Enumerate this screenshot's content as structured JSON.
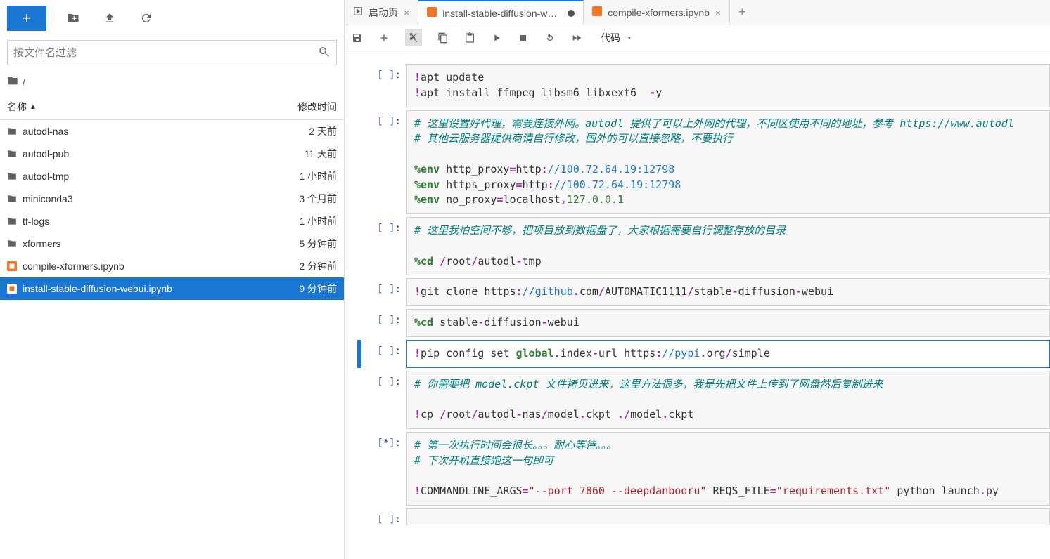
{
  "sidebar": {
    "search_placeholder": "按文件名过滤",
    "breadcrumb_root": "/",
    "header_name": "名称",
    "header_modified": "修改时间",
    "files": [
      {
        "name": "autodl-nas",
        "modified": "2 天前",
        "type": "folder"
      },
      {
        "name": "autodl-pub",
        "modified": "11 天前",
        "type": "folder"
      },
      {
        "name": "autodl-tmp",
        "modified": "1 小时前",
        "type": "folder"
      },
      {
        "name": "miniconda3",
        "modified": "3 个月前",
        "type": "folder"
      },
      {
        "name": "tf-logs",
        "modified": "1 小时前",
        "type": "folder"
      },
      {
        "name": "xformers",
        "modified": "5 分钟前",
        "type": "folder"
      },
      {
        "name": "compile-xformers.ipynb",
        "modified": "2 分钟前",
        "type": "notebook"
      },
      {
        "name": "install-stable-diffusion-webui.ipynb",
        "modified": "9 分钟前",
        "type": "notebook",
        "selected": true
      }
    ]
  },
  "tabs": [
    {
      "label": "启动页",
      "icon": "launcher",
      "closable": true
    },
    {
      "label": "install-stable-diffusion-webu",
      "icon": "notebook",
      "active": true,
      "dirty": true
    },
    {
      "label": "compile-xformers.ipynb",
      "icon": "notebook",
      "closable": true
    }
  ],
  "nb_toolbar": {
    "cell_type": "代码"
  },
  "cells": [
    {
      "prompt": "[ ]:",
      "tokens": [
        [
          "op",
          "!"
        ],
        [
          "",
          "apt update\n"
        ],
        [
          "op",
          "!"
        ],
        [
          "",
          "apt install ffmpeg libsm6 libxext6  "
        ],
        [
          "op",
          "-"
        ],
        [
          "",
          "y"
        ]
      ]
    },
    {
      "prompt": "[ ]:",
      "tokens": [
        [
          "cm",
          "# 这里设置好代理，需要连接外网。autodl 提供了可以上外网的代理，不同区使用不同的地址，参考 https://www.autodl"
        ],
        [
          "",
          "\n"
        ],
        [
          "cm",
          "# 其他云服务器提供商请自行修改，国外的可以直接忽略，不要执行"
        ],
        [
          "",
          "\n\n"
        ],
        [
          "mg",
          "%env"
        ],
        [
          "",
          " http_proxy"
        ],
        [
          "op",
          "="
        ],
        [
          "",
          "http"
        ],
        [
          "op",
          ":"
        ],
        [
          "url",
          "//100.72.64.19:12798"
        ],
        [
          "",
          "\n"
        ],
        [
          "mg",
          "%env"
        ],
        [
          "",
          " https_proxy"
        ],
        [
          "op",
          "="
        ],
        [
          "",
          "http"
        ],
        [
          "op",
          ":"
        ],
        [
          "url",
          "//100.72.64.19:12798"
        ],
        [
          "",
          "\n"
        ],
        [
          "mg",
          "%env"
        ],
        [
          "",
          " no_proxy"
        ],
        [
          "op",
          "="
        ],
        [
          "",
          "localhost"
        ],
        [
          "op",
          ","
        ],
        [
          "num",
          "127.0.0.1"
        ]
      ]
    },
    {
      "prompt": "[ ]:",
      "tokens": [
        [
          "cm",
          "# 这里我怕空间不够，把项目放到数据盘了，大家根据需要自行调整存放的目录"
        ],
        [
          "",
          "\n\n"
        ],
        [
          "mg",
          "%cd"
        ],
        [
          "",
          " "
        ],
        [
          "op",
          "/"
        ],
        [
          "",
          "root"
        ],
        [
          "op",
          "/"
        ],
        [
          "",
          "autodl"
        ],
        [
          "op",
          "-"
        ],
        [
          "",
          "tmp"
        ]
      ]
    },
    {
      "prompt": "[ ]:",
      "tokens": [
        [
          "op",
          "!"
        ],
        [
          "",
          "git clone https"
        ],
        [
          "op",
          ":"
        ],
        [
          "url",
          "//github"
        ],
        [
          "op",
          "."
        ],
        [
          "",
          "com"
        ],
        [
          "op",
          "/"
        ],
        [
          "",
          "AUTOMATIC1111"
        ],
        [
          "op",
          "/"
        ],
        [
          "",
          "stable"
        ],
        [
          "op",
          "-"
        ],
        [
          "",
          "diffusion"
        ],
        [
          "op",
          "-"
        ],
        [
          "",
          "webui"
        ]
      ]
    },
    {
      "prompt": "[ ]:",
      "tokens": [
        [
          "mg",
          "%cd"
        ],
        [
          "",
          " stable"
        ],
        [
          "op",
          "-"
        ],
        [
          "",
          "diffusion"
        ],
        [
          "op",
          "-"
        ],
        [
          "",
          "webui"
        ]
      ]
    },
    {
      "prompt": "[ ]:",
      "selected": true,
      "tokens": [
        [
          "op",
          "!"
        ],
        [
          "",
          "pip config set "
        ],
        [
          "kw",
          "global"
        ],
        [
          "op",
          "."
        ],
        [
          "",
          "index"
        ],
        [
          "op",
          "-"
        ],
        [
          "",
          "url https"
        ],
        [
          "op",
          ":"
        ],
        [
          "url",
          "//pypi"
        ],
        [
          "op",
          "."
        ],
        [
          "",
          "org"
        ],
        [
          "op",
          "/"
        ],
        [
          "",
          "simple"
        ]
      ]
    },
    {
      "prompt": "[ ]:",
      "tokens": [
        [
          "cm",
          "# 你需要把 model.ckpt 文件拷贝进来，这里方法很多，我是先把文件上传到了网盘然后复制进来"
        ],
        [
          "",
          "\n\n"
        ],
        [
          "op",
          "!"
        ],
        [
          "",
          "cp "
        ],
        [
          "op",
          "/"
        ],
        [
          "",
          "root"
        ],
        [
          "op",
          "/"
        ],
        [
          "",
          "autodl"
        ],
        [
          "op",
          "-"
        ],
        [
          "",
          "nas"
        ],
        [
          "op",
          "/"
        ],
        [
          "",
          "model"
        ],
        [
          "op",
          "."
        ],
        [
          "",
          "ckpt "
        ],
        [
          "op",
          "."
        ],
        [
          "op",
          "/"
        ],
        [
          "",
          "model"
        ],
        [
          "op",
          "."
        ],
        [
          "",
          "ckpt"
        ]
      ]
    },
    {
      "prompt": "[*]:",
      "tokens": [
        [
          "cm",
          "# 第一次执行时间会很长。。。耐心等待。。。"
        ],
        [
          "",
          "\n"
        ],
        [
          "cm",
          "# 下次开机直接跑这一句即可"
        ],
        [
          "",
          "\n\n"
        ],
        [
          "op",
          "!"
        ],
        [
          "",
          "COMMANDLINE_ARGS"
        ],
        [
          "op",
          "="
        ],
        [
          "str",
          "\"--port 7860 --deepdanbooru\""
        ],
        [
          "",
          " REQS_FILE"
        ],
        [
          "op",
          "="
        ],
        [
          "str",
          "\"requirements.txt\""
        ],
        [
          "",
          " python launch"
        ],
        [
          "op",
          "."
        ],
        [
          "",
          "py"
        ]
      ]
    },
    {
      "prompt": "[ ]:",
      "tokens": [
        [
          "",
          ""
        ]
      ]
    }
  ]
}
